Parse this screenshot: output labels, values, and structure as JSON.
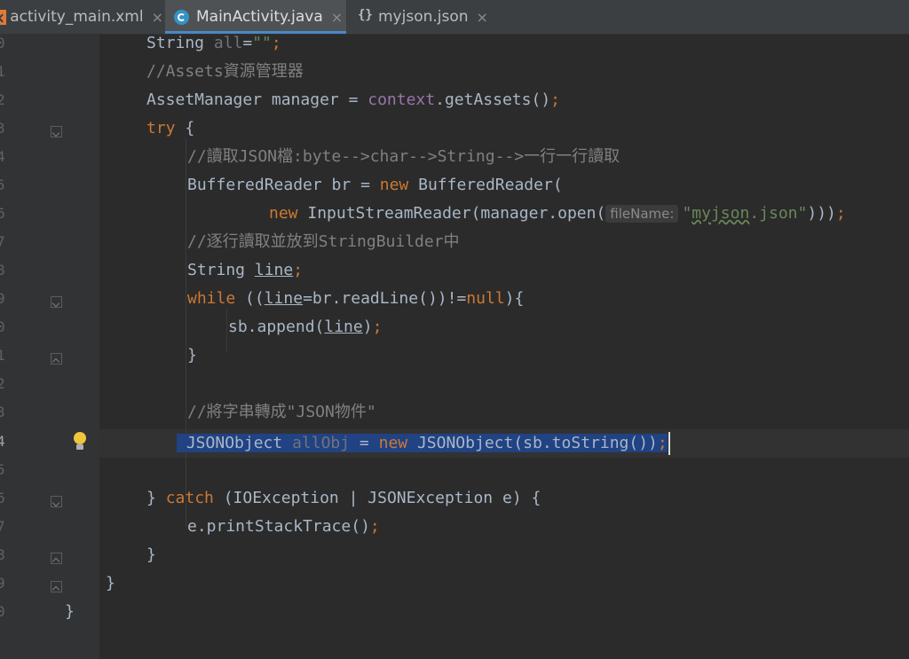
{
  "tabs": [
    {
      "label": "activity_main.xml",
      "icon": "xml-file-icon",
      "active": false
    },
    {
      "label": "MainActivity.java",
      "icon": "java-class-icon",
      "active": true
    },
    {
      "label": "myjson.json",
      "icon": "json-file-icon",
      "active": false
    }
  ],
  "close_glyph": "×",
  "gutter": {
    "line_numbers": [
      "0",
      "1",
      "2",
      "3",
      "4",
      "5",
      "6",
      "7",
      "8",
      "9",
      "0",
      "1",
      "2",
      "3",
      "4",
      "5",
      "6",
      "7",
      "8",
      "9",
      "0"
    ]
  },
  "code": {
    "l0": {
      "a": "String ",
      "b": "all",
      "c": "=",
      "d": "\"\"",
      "e": ";"
    },
    "l1": {
      "comment": "//Assets資源管理器"
    },
    "l2": {
      "a": "AssetManager manager = ",
      "b": "context",
      "c": ".getAssets()",
      "d": ";"
    },
    "l3": {
      "kw": "try",
      "a": " {"
    },
    "l4": {
      "comment": "//讀取JSON檔:byte-->char-->String-->一行一行讀取"
    },
    "l5": {
      "a": "BufferedReader br = ",
      "kw": "new",
      "b": " BufferedReader("
    },
    "l6": {
      "kw": "new",
      "a": " InputStreamReader(manager.open(",
      "hint": "fileName:",
      "str_q1": "\"",
      "str_body": "myjson",
      "str_rest": ".json\"",
      "b": ")))",
      "c": ";"
    },
    "l7": {
      "comment": "//逐行讀取並放到StringBuilder中"
    },
    "l8": {
      "a": "String ",
      "b": "line",
      "c": ";"
    },
    "l9": {
      "kw": "while",
      "a": " ((",
      "b": "line",
      "c": "=br.readLine())!=",
      "kw2": "null",
      "d": "){"
    },
    "l10": {
      "a": "sb.append(",
      "b": "line",
      "c": ")",
      "d": ";"
    },
    "l11": {
      "a": "}"
    },
    "l13": {
      "comment": "//將字串轉成\"JSON物件\""
    },
    "l14": {
      "a": "JSONObject ",
      "b": "allObj",
      "c": " = ",
      "kw": "new",
      "d": " JSONObject(sb.toString())",
      "e": ";"
    },
    "l16": {
      "a": "} ",
      "kw": "catch",
      "b": " (IOException | JSONException e) {"
    },
    "l17": {
      "a": "e.printStackTrace()",
      "b": ";"
    },
    "l18": {
      "a": "}"
    },
    "l19": {
      "a": "}"
    },
    "l20": {
      "a": "}"
    }
  }
}
